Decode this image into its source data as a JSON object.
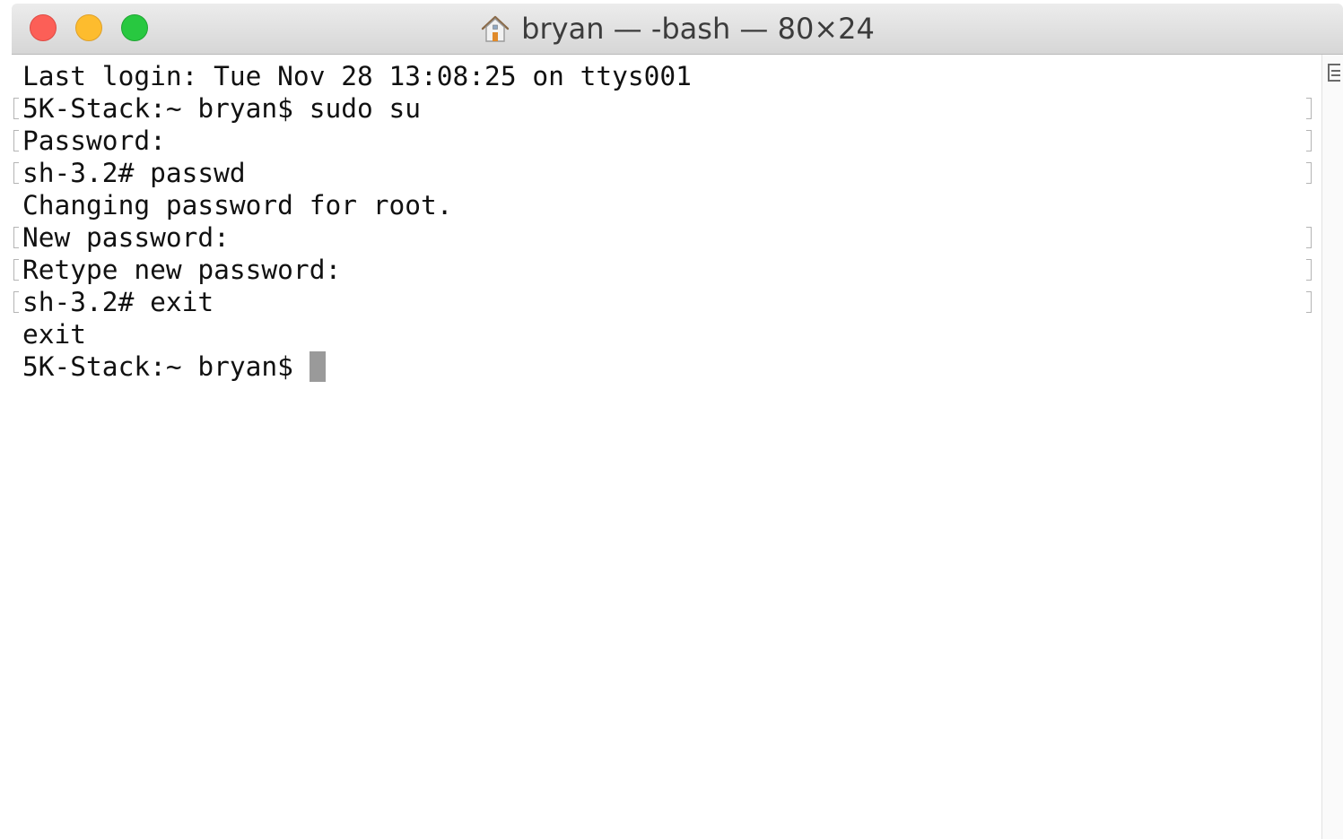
{
  "window": {
    "title": "bryan — -bash — 80×24",
    "title_icon": "home-icon",
    "traffic_lights": {
      "close_color": "#fc5f57",
      "minimize_color": "#fdbc2e",
      "zoom_color": "#28c840"
    }
  },
  "terminal": {
    "lines": [
      {
        "text": "Last login: Tue Nov 28 13:08:25 on ttys001",
        "marked": false
      },
      {
        "text": "5K-Stack:~ bryan$ sudo su",
        "marked": true
      },
      {
        "text": "Password:",
        "marked": true
      },
      {
        "text": "sh-3.2# passwd",
        "marked": true
      },
      {
        "text": "Changing password for root.",
        "marked": false
      },
      {
        "text": "New password:",
        "marked": true
      },
      {
        "text": "Retype new password:",
        "marked": true
      },
      {
        "text": "sh-3.2# exit",
        "marked": true
      },
      {
        "text": "exit",
        "marked": false
      },
      {
        "text": "5K-Stack:~ bryan$",
        "marked": false
      }
    ],
    "cursor_color": "#9a9a9a"
  },
  "scrollbar": {
    "icon": "split-pane-icon"
  }
}
